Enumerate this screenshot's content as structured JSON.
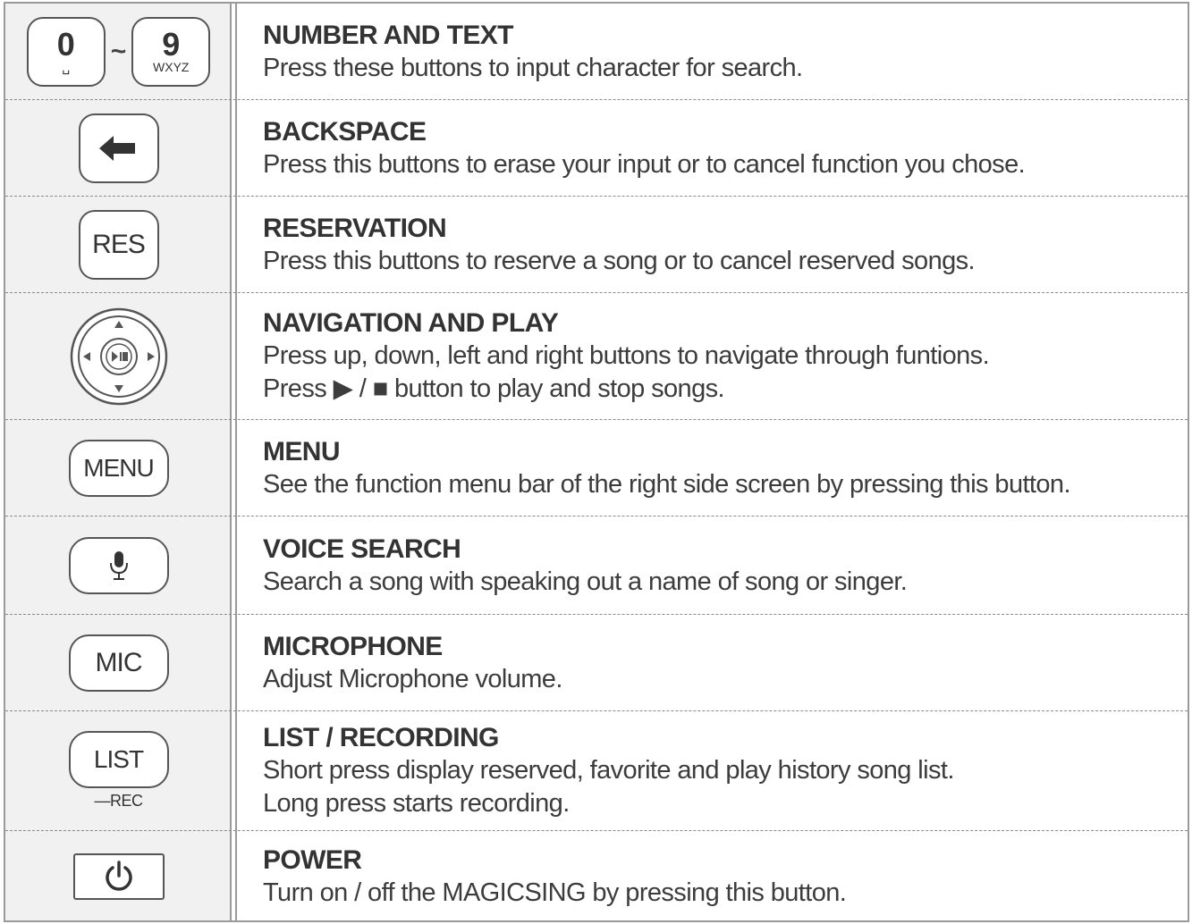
{
  "icons": {
    "key_zero": "0",
    "key_zero_sub": "␣",
    "tilde": "~",
    "key_nine": "9",
    "key_nine_sub": "WXYZ",
    "res": "RES",
    "menu": "MENU",
    "mic": "MIC",
    "list": "LIST",
    "list_sub": "—REC"
  },
  "rows": [
    {
      "title": "NUMBER AND TEXT",
      "lines": [
        "Press these buttons to input character for search."
      ]
    },
    {
      "title": "BACKSPACE",
      "lines": [
        "Press this buttons to erase your input or to cancel function you chose."
      ]
    },
    {
      "title": "RESERVATION",
      "lines": [
        "Press this buttons to reserve a song or to cancel reserved songs."
      ]
    },
    {
      "title": "NAVIGATION AND PLAY",
      "lines": [
        "Press up, down, left and right buttons to navigate through funtions.",
        "Press ▶ / ■ button to play and stop songs."
      ]
    },
    {
      "title": "MENU",
      "lines": [
        "See the function menu bar of the right side screen by pressing this button."
      ]
    },
    {
      "title": "VOICE SEARCH",
      "lines": [
        "Search a song with speaking out a name of song or singer."
      ]
    },
    {
      "title": "MICROPHONE",
      "lines": [
        "Adjust Microphone volume."
      ]
    },
    {
      "title": "LIST / RECORDING",
      "lines": [
        "Short press display reserved, favorite and play history song list.",
        "Long press starts recording."
      ]
    },
    {
      "title": "POWER",
      "lines": [
        "Turn on / off the MAGICSING by pressing this button."
      ]
    }
  ]
}
